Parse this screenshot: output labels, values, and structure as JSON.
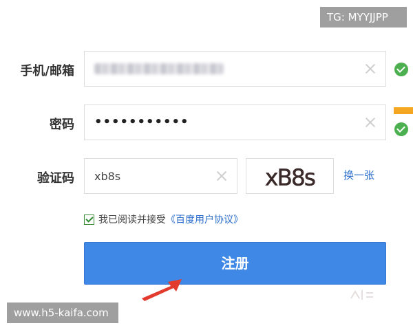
{
  "watermarks": {
    "top_right": "TG: MYYJJPP",
    "bottom_left": "www.h5-kaifa.com"
  },
  "form": {
    "account": {
      "label": "手机/邮箱",
      "value_state": "blurred"
    },
    "password": {
      "label": "密码",
      "masked_value": "•••••••••••"
    },
    "captcha": {
      "label": "验证码",
      "value": "xb8s",
      "image_text": "xB8s",
      "refresh_label": "换一张"
    },
    "agreement": {
      "checked": true,
      "text": "我已阅读并接受",
      "link_text": "《百度用户协议》"
    },
    "submit_label": "注册"
  },
  "colors": {
    "primary_button": "#3f88e6",
    "link": "#2b6ecc",
    "success": "#4caf50",
    "strength_bar": "#f5a623"
  },
  "icons": {
    "clear": "clear-x-icon",
    "valid": "check-circle-icon",
    "pointer": "red-arrow-icon"
  }
}
